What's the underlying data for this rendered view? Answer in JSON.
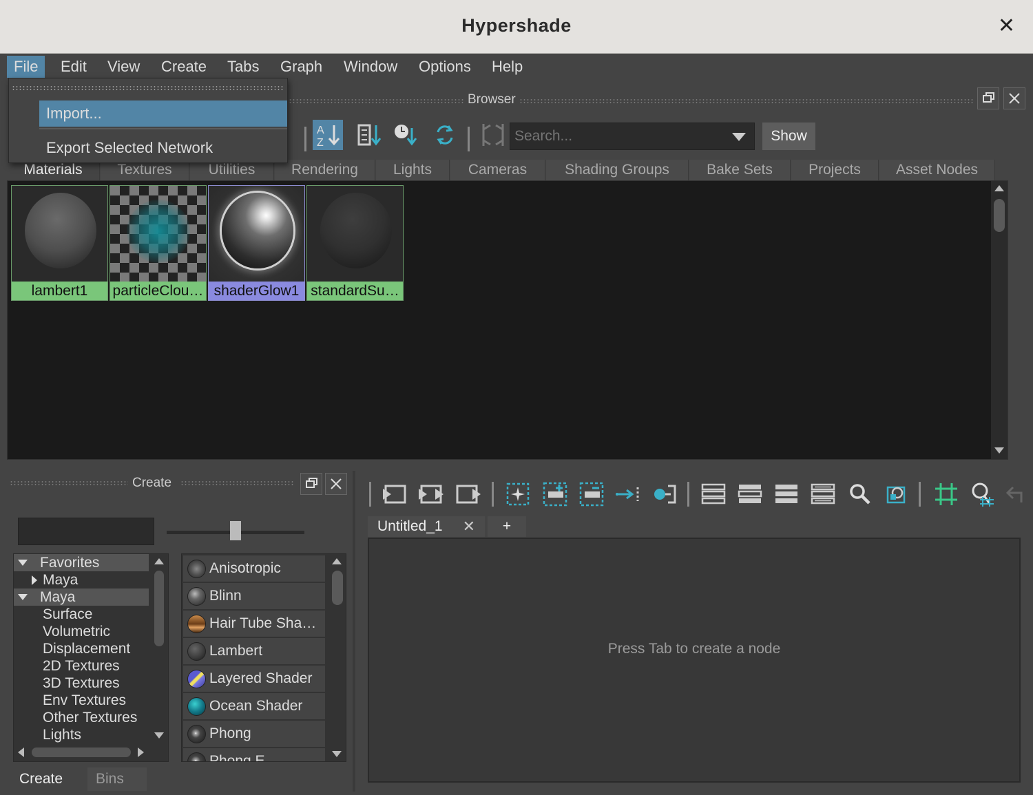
{
  "window": {
    "title": "Hypershade",
    "close_glyph": "✕"
  },
  "menubar": [
    "File",
    "Edit",
    "View",
    "Create",
    "Tabs",
    "Graph",
    "Window",
    "Options",
    "Help"
  ],
  "file_menu": {
    "items": [
      "Import...",
      "Export Selected Network"
    ],
    "highlighted": "Import..."
  },
  "browser": {
    "label": "Browser",
    "search": {
      "placeholder": "Search..."
    },
    "show_button": "Show",
    "tabs": [
      "Materials",
      "Textures",
      "Utilities",
      "Rendering",
      "Lights",
      "Cameras",
      "Shading Groups",
      "Bake Sets",
      "Projects",
      "Asset Nodes"
    ],
    "active_tab": "Materials",
    "swatches": [
      {
        "name": "lambert1",
        "type": "lambert"
      },
      {
        "name": "particleClou…",
        "type": "particle-cloud"
      },
      {
        "name": "shaderGlow1",
        "type": "shader-glow"
      },
      {
        "name": "standardSu…",
        "type": "standard-surface"
      }
    ]
  },
  "create_panel": {
    "label": "Create",
    "tree": [
      {
        "label": "Favorites",
        "kind": "header-expanded"
      },
      {
        "label": "Maya",
        "kind": "child-collapsed"
      },
      {
        "label": "Maya",
        "kind": "header-expanded"
      },
      {
        "label": "Surface",
        "kind": "item"
      },
      {
        "label": "Volumetric",
        "kind": "item"
      },
      {
        "label": "Displacement",
        "kind": "item"
      },
      {
        "label": "2D Textures",
        "kind": "item"
      },
      {
        "label": "3D Textures",
        "kind": "item"
      },
      {
        "label": "Env Textures",
        "kind": "item"
      },
      {
        "label": "Other Textures",
        "kind": "item"
      },
      {
        "label": "Lights",
        "kind": "item"
      }
    ],
    "nodes": [
      {
        "label": "Anisotropic",
        "icon": "anisotropic-icon"
      },
      {
        "label": "Blinn",
        "icon": "blinn-icon"
      },
      {
        "label": "Hair Tube Sha…",
        "icon": "hair-tube-icon"
      },
      {
        "label": "Lambert",
        "icon": "lambert-icon"
      },
      {
        "label": "Layered Shader",
        "icon": "layered-shader-icon"
      },
      {
        "label": "Ocean Shader",
        "icon": "ocean-shader-icon"
      },
      {
        "label": "Phong",
        "icon": "phong-icon"
      },
      {
        "label": "Phong E",
        "icon": "phong-e-icon"
      }
    ],
    "bottom_tabs": [
      "Create",
      "Bins"
    ],
    "active_bottom_tab": "Create"
  },
  "graph": {
    "tabs": [
      "Untitled_1"
    ],
    "add_tab": "+",
    "tab_close": "✕",
    "hint": "Press Tab to create a node"
  },
  "colors": {
    "accent": "#5285a6",
    "swatch_label": "#7ac67a",
    "swatch_label_selected": "#8a8adf",
    "icon_teal": "#3ab0c8"
  }
}
